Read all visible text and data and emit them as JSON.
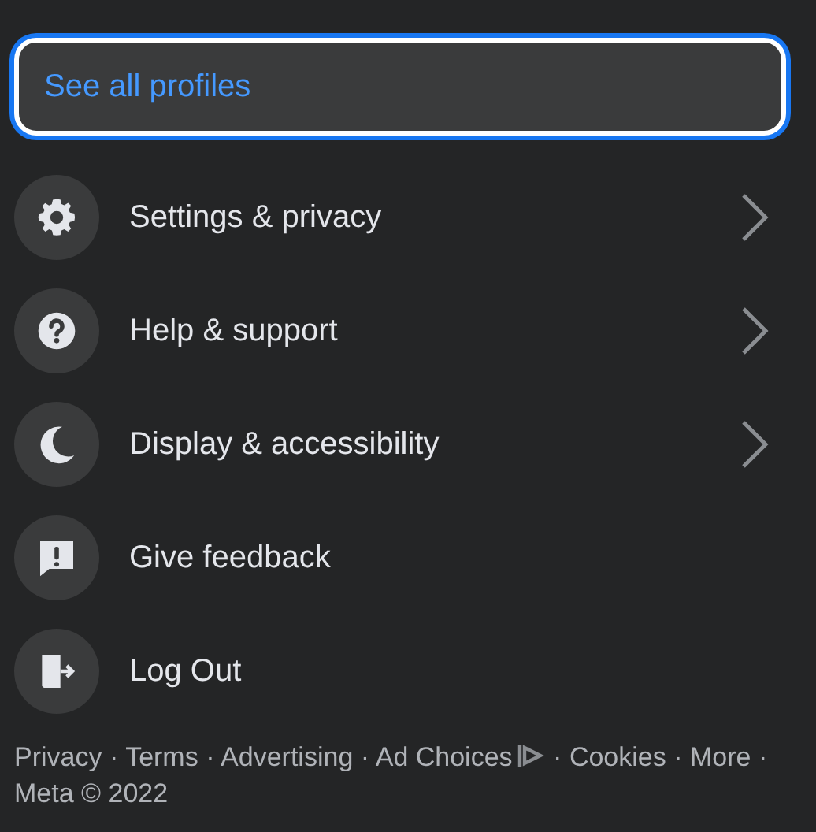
{
  "profiles_button": {
    "label": "See all profiles",
    "focused": true
  },
  "menu": [
    {
      "kind": "settings",
      "label": "Settings & privacy",
      "has_submenu": true
    },
    {
      "kind": "help",
      "label": "Help & support",
      "has_submenu": true
    },
    {
      "kind": "display",
      "label": "Display & accessibility",
      "has_submenu": true
    },
    {
      "kind": "feedback",
      "label": "Give feedback",
      "has_submenu": false
    },
    {
      "kind": "logout",
      "label": "Log Out",
      "has_submenu": false
    }
  ],
  "footer": {
    "separator": "·",
    "links": [
      {
        "label": "Privacy",
        "kind": "link"
      },
      {
        "label": "Terms",
        "kind": "link"
      },
      {
        "label": "Advertising",
        "kind": "link"
      },
      {
        "label": "Ad Choices",
        "kind": "adchoices"
      },
      {
        "label": "Cookies",
        "kind": "link"
      },
      {
        "label": "More",
        "kind": "link"
      },
      {
        "label": "Meta © 2022",
        "kind": "text"
      }
    ]
  }
}
